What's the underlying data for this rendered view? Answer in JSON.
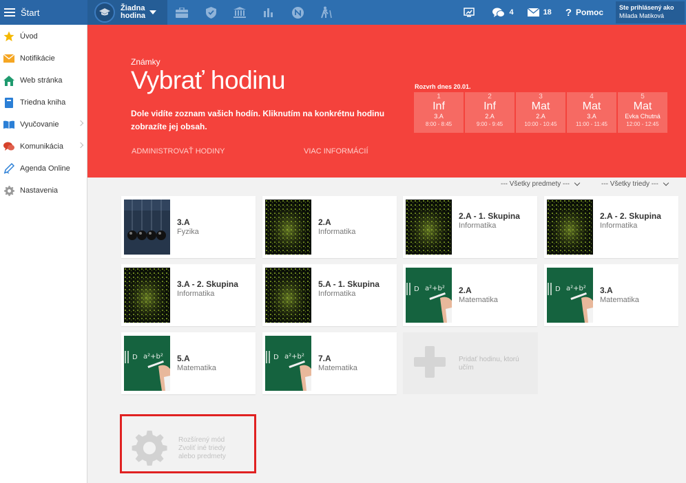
{
  "topbar": {
    "start_label": "Štart",
    "lesson_select_label": "Žiadna hodina",
    "nav_icons": [
      "briefcase-icon",
      "shield-icon",
      "bank-icon",
      "bar-chart-icon",
      "badge-icon",
      "hiking-icon"
    ],
    "screen_share_icon": "cast-icon",
    "messages_count": "4",
    "mail_count": "18",
    "help_label": "Pomoc",
    "user_line1": "Ste prihlásený ako",
    "user_line2": "Milada Matiková"
  },
  "sidebar": {
    "items": [
      {
        "label": "Úvod",
        "icon": "star-icon",
        "has_submenu": false
      },
      {
        "label": "Notifikácie",
        "icon": "envelope-icon",
        "has_submenu": false
      },
      {
        "label": "Web stránka",
        "icon": "home-icon",
        "has_submenu": false
      },
      {
        "label": "Triedna kniha",
        "icon": "book-icon",
        "has_submenu": false
      },
      {
        "label": "Vyučovanie",
        "icon": "open-book-icon",
        "has_submenu": true
      },
      {
        "label": "Komunikácia",
        "icon": "chat-icon",
        "has_submenu": true
      },
      {
        "label": "Agenda Online",
        "icon": "pen-icon",
        "has_submenu": false
      },
      {
        "label": "Nastavenia",
        "icon": "gear-icon",
        "has_submenu": false
      }
    ]
  },
  "hero": {
    "subtitle": "Známky",
    "title": "Vybrať hodinu",
    "description": "Dole vidíte zoznam vašich hodín. Kliknutím na konkrétnu hodinu zobrazíte jej obsah.",
    "link_admin": "ADMINISTROVAŤ HODINY",
    "link_more": "VIAC INFORMÁCIÍ",
    "schedule_caption": "Rozvrh dnes 20.01.",
    "schedule": [
      {
        "num": "1",
        "subject": "Inf",
        "class": "3.A",
        "time": "8:00 - 8:45"
      },
      {
        "num": "2",
        "subject": "Inf",
        "class": "2.A",
        "time": "9:00 - 9:45"
      },
      {
        "num": "3",
        "subject": "Mat",
        "class": "2.A",
        "time": "10:00 - 10:45"
      },
      {
        "num": "4",
        "subject": "Mat",
        "class": "3.A",
        "time": "11:00 - 11:45"
      },
      {
        "num": "5",
        "subject": "Mat",
        "class": "Evka Chutná",
        "time": "12:00 - 12:45"
      }
    ]
  },
  "filters": {
    "subjects": "--- Všetky predmety ---",
    "classes": "--- Všetky triedy ---"
  },
  "lessons": [
    {
      "title": "3.A",
      "subject": "Fyzika",
      "thumb": "physics"
    },
    {
      "title": "2.A",
      "subject": "Informatika",
      "thumb": "matrix"
    },
    {
      "title": "2.A - 1. Skupina",
      "subject": "Informatika",
      "thumb": "matrix"
    },
    {
      "title": "2.A - 2. Skupina",
      "subject": "Informatika",
      "thumb": "matrix"
    },
    {
      "title": "3.A - 2. Skupina",
      "subject": "Informatika",
      "thumb": "matrix"
    },
    {
      "title": "5.A - 1. Skupina",
      "subject": "Informatika",
      "thumb": "matrix"
    },
    {
      "title": "2.A",
      "subject": "Matematika",
      "thumb": "board"
    },
    {
      "title": "3.A",
      "subject": "Matematika",
      "thumb": "board"
    },
    {
      "title": "5.A",
      "subject": "Matematika",
      "thumb": "board"
    },
    {
      "title": "7.A",
      "subject": "Matematika",
      "thumb": "board"
    }
  ],
  "add_lesson_label": "Pridať hodinu, ktorú učím",
  "advanced": {
    "line1": "Rozšírený mód",
    "line2": "Zvoliť iné triedy",
    "line3": "alebo predmety"
  },
  "colors": {
    "topbar": "#2e6fb0",
    "hero": "#f4423c",
    "schedule_cell": "#f66a63",
    "highlight_border": "#e02121"
  }
}
